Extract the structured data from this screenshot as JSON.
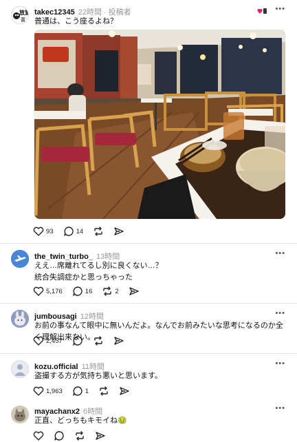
{
  "posts": [
    {
      "username": "takec12345",
      "time": "22時間",
      "role": "投稿者",
      "text": "普通は、こう座るよね？",
      "likes": "93",
      "replies": "14",
      "reposts": "",
      "avatar_text": "放置"
    },
    {
      "username": "the_twin_turbo_",
      "time": "13時間",
      "text_lines": [
        "ええ…席離れてるし別に良くない…？",
        "統合失調症かと思っちゃった"
      ],
      "likes": "5,176",
      "replies": "16",
      "reposts": "2"
    },
    {
      "username": "jumbousagi",
      "time": "12時間",
      "text": "お前の事なんて眼中に無いんだよ。なんでお前みたいな思考になるのか全く理解出来ない。",
      "likes": "2,457",
      "replies": "",
      "reposts": ""
    },
    {
      "username": "kozu.official",
      "time": "11時間",
      "text": "盗撮する方が気持ち悪いと思います。",
      "likes": "1,963",
      "replies": "1",
      "reposts": ""
    },
    {
      "username": "mayachanx2",
      "time": "6時間",
      "text": "正直、どっちもキモイね🤢",
      "likes": "",
      "replies": "",
      "reposts": ""
    }
  ],
  "icons": {
    "like": "heart-icon",
    "reply": "comment-icon",
    "repost": "repost-icon",
    "share": "share-icon",
    "more": "more-icon"
  },
  "colors": {
    "text": "#101010",
    "muted": "#999999",
    "divider": "#e5e5e5",
    "badge_heart": "#e0245e"
  }
}
